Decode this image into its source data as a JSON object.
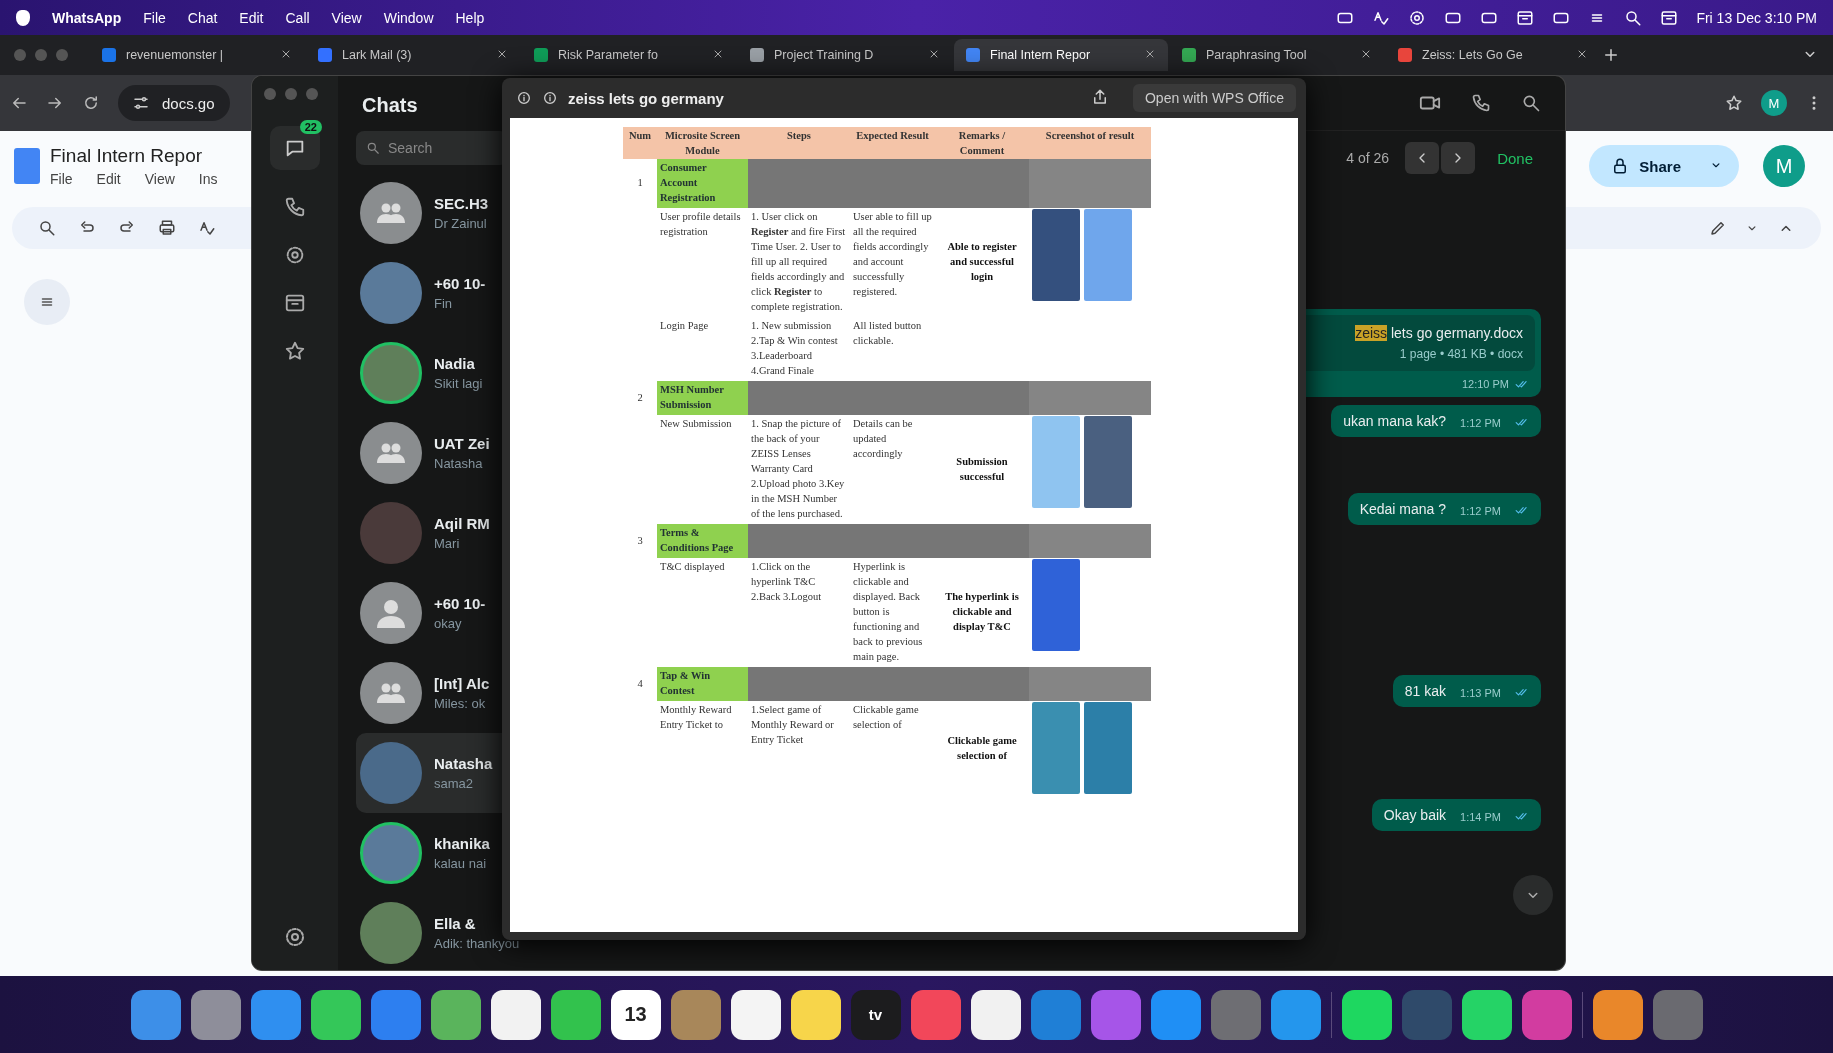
{
  "menubar": {
    "app": "WhatsApp",
    "menus": [
      "File",
      "Chat",
      "Edit",
      "Call",
      "View",
      "Window",
      "Help"
    ],
    "clock": "Fri 13 Dec 3:10 PM"
  },
  "browser": {
    "tabs": [
      {
        "title": "revenuemonster |",
        "selected": false,
        "color": "#1a73e8"
      },
      {
        "title": "Lark Mail (3)",
        "selected": false,
        "color": "#3370ff"
      },
      {
        "title": "Risk Parameter fo",
        "selected": false,
        "color": "#0f9d58"
      },
      {
        "title": "Project Training D",
        "selected": false,
        "color": "#9aa0a6"
      },
      {
        "title": "Final Intern Repor",
        "selected": true,
        "color": "#4285f4"
      },
      {
        "title": "Paraphrasing Tool",
        "selected": false,
        "color": "#34a853"
      },
      {
        "title": "Zeiss: Lets Go Ge",
        "selected": false,
        "color": "#e8453c"
      }
    ],
    "address": "docs.go",
    "profile": "M",
    "document": {
      "title": "Final Intern Repor",
      "menus": [
        "File",
        "Edit",
        "View",
        "Ins"
      ],
      "share": "Share",
      "avatar": "M"
    }
  },
  "whatsapp": {
    "badge": "22",
    "heading": "Chats",
    "search_placeholder": "Search",
    "chats": [
      {
        "name": "SEC.H3",
        "preview": "Dr Zainul",
        "kind": "group",
        "unseen_status": false,
        "selected": false
      },
      {
        "name": "+60 10-",
        "preview": "Fin",
        "kind": "photo",
        "unseen_status": false,
        "selected": false
      },
      {
        "name": "Nadia",
        "preview": "Sikit lagi",
        "kind": "photo",
        "unseen_status": true,
        "selected": false
      },
      {
        "name": "UAT Zei",
        "preview": "Natasha",
        "kind": "group",
        "unseen_status": false,
        "selected": false
      },
      {
        "name": "Aqil RM",
        "preview": "Mari",
        "kind": "photo",
        "unseen_status": false,
        "selected": false
      },
      {
        "name": "+60 10-",
        "preview": "okay",
        "kind": "person",
        "unseen_status": false,
        "selected": false
      },
      {
        "name": "[Int] Alc",
        "preview": "Miles: ok",
        "kind": "group",
        "unseen_status": false,
        "selected": false
      },
      {
        "name": "Natasha",
        "preview": "sama2",
        "kind": "photo",
        "unseen_status": false,
        "selected": true
      },
      {
        "name": "khanika",
        "preview": "kalau nai",
        "kind": "photo",
        "unseen_status": true,
        "selected": false
      },
      {
        "name": "Ella &",
        "preview": "Adik: thankyou",
        "kind": "photo",
        "unseen_status": false,
        "selected": false
      }
    ],
    "find": {
      "count": "4 of 26",
      "done": "Done"
    },
    "messages": [
      {
        "kind": "document",
        "highlight": "zeiss",
        "text": " lets go germany.docx",
        "meta": "1 page • 481 KB • docx",
        "time": "12:10 PM"
      },
      {
        "kind": "text",
        "text": "ukan mana kak?",
        "time": "1:12 PM"
      },
      {
        "kind": "text",
        "text": "Kedai mana ?",
        "time": "1:12 PM"
      },
      {
        "kind": "text",
        "text": "81 kak",
        "time": "1:13 PM"
      },
      {
        "kind": "text",
        "text": "Okay baik",
        "time": "1:14 PM"
      }
    ]
  },
  "preview": {
    "title": "zeiss lets go germany",
    "open_button": "Open with WPS Office",
    "table": {
      "columns": [
        "Num",
        "Microsite Screen Module",
        "Steps",
        "Expected Result",
        "Remarks / Comment",
        "Screenshot of result"
      ],
      "sections": [
        {
          "number": "1",
          "module": "Consumer Account Registration",
          "rows": [
            {
              "module": "User profile details registration",
              "steps": "1. User click on **Register**  and fire First Time User. 2. User to fill up all required fields accordingly and click **Register** to complete registration.",
              "expected": "User able to fill up all the required fields accordingly and account successfully registered.",
              "remarks": "Able to register and successful login",
              "screenshots": [
                {
                  "color": "#34507e"
                },
                {
                  "color": "#6fa6ec"
                }
              ]
            },
            {
              "module": "Login Page",
              "steps": "1. New submission 2.Tap & Win contest 3.Leaderboard 4.Grand Finale",
              "expected": "All listed button clickable.",
              "screenshots": []
            }
          ]
        },
        {
          "number": "2",
          "module": "MSH Number Submission",
          "rows": [
            {
              "module": "New Submission",
              "steps": "1. Snap the picture of the back of your ZEISS Lenses Warranty Card 2.Upload photo 3.Key in the MSH Number of the lens purchased.",
              "expected": "Details can be updated accordingly",
              "remarks": "Submission successful",
              "screenshots": [
                {
                  "color": "#8fc4f0"
                },
                {
                  "color": "#4a6080"
                }
              ]
            }
          ]
        },
        {
          "number": "3",
          "module": "Terms & Conditions Page",
          "rows": [
            {
              "module": "T&C displayed",
              "steps": "1.Click on the hyperlink T&C 2.Back 3.Logout",
              "expected": "Hyperlink is clickable and displayed. Back button is functioning and back to previous main page.",
              "remarks": "The hyperlink is clickable and display T&C",
              "screenshots": [
                {
                  "color": "#2f62d8"
                }
              ]
            }
          ]
        },
        {
          "number": "4",
          "module": "Tap & Win Contest",
          "rows": [
            {
              "module": "Monthly Reward Entry Ticket to",
              "steps": "1.Select game of Monthly Reward or Entry Ticket",
              "expected": "Clickable game selection of",
              "remarks": "Clickable game selection of",
              "screenshots": [
                {
                  "color": "#3a8fb0"
                },
                {
                  "color": "#2c7fa8"
                }
              ]
            }
          ]
        }
      ]
    }
  },
  "dock": [
    {
      "kind": "app",
      "color": "#3d8fe8"
    },
    {
      "kind": "app",
      "color": "#8e8e9a"
    },
    {
      "kind": "app",
      "color": "#2f8ff0"
    },
    {
      "kind": "app",
      "color": "#34c759"
    },
    {
      "kind": "app",
      "color": "#2d7ff0"
    },
    {
      "kind": "app",
      "color": "#5ab45c"
    },
    {
      "kind": "app",
      "color": "#f2f2f2"
    },
    {
      "kind": "app",
      "color": "#32c24d"
    },
    {
      "kind": "calendar",
      "color": "#ffffff",
      "label": "13"
    },
    {
      "kind": "app",
      "color": "#a8875a"
    },
    {
      "kind": "app",
      "color": "#f4f4f4"
    },
    {
      "kind": "app",
      "color": "#f7d54a"
    },
    {
      "kind": "tv",
      "color": "#1c1c1e",
      "label": "tv"
    },
    {
      "kind": "app",
      "color": "#f2475a"
    },
    {
      "kind": "app",
      "color": "#f1f1f1"
    },
    {
      "kind": "app",
      "color": "#1f7fd6"
    },
    {
      "kind": "app",
      "color": "#a655e8"
    },
    {
      "kind": "app",
      "color": "#1f8ff5"
    },
    {
      "kind": "app",
      "color": "#6e6e73"
    },
    {
      "kind": "app",
      "color": "#2496ed"
    },
    {
      "kind": "divider",
      "color": "#5a4a7a"
    },
    {
      "kind": "app",
      "color": "#1ed760"
    },
    {
      "kind": "app",
      "color": "#2f4a6a"
    },
    {
      "kind": "app",
      "color": "#25d366"
    },
    {
      "kind": "app",
      "color": "#d23ca0"
    },
    {
      "kind": "divider",
      "color": "#5a4a7a"
    },
    {
      "kind": "app",
      "color": "#e9872a"
    },
    {
      "kind": "app",
      "color": "#6a6a70"
    }
  ]
}
